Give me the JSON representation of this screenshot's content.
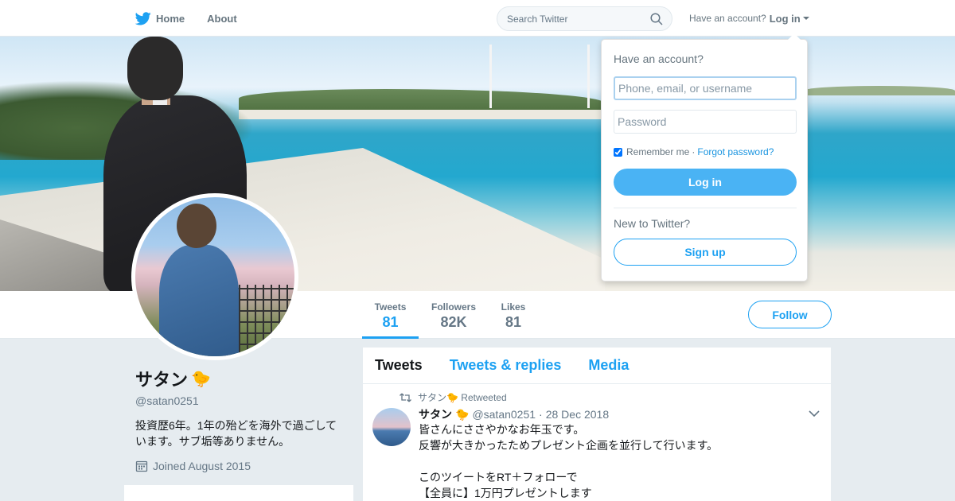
{
  "colors": {
    "brand": "#1da1f2",
    "button_blue": "#4ab3f4",
    "text_primary": "#14171a",
    "text_secondary": "#657786",
    "background": "#e6ecf0"
  },
  "nav": {
    "home_label": "Home",
    "home_icon": "twitter-bird-icon",
    "about_label": "About",
    "search_placeholder": "Search Twitter",
    "search_icon": "search-icon",
    "have_account_label": "Have an account?",
    "login_label": "Log in"
  },
  "login_dropdown": {
    "title": "Have an account?",
    "username_placeholder": "Phone, email, or username",
    "password_placeholder": "Password",
    "remember_label": "Remember me",
    "separator": "·",
    "forgot_label": "Forgot password?",
    "login_button": "Log in",
    "new_label": "New to Twitter?",
    "signup_button": "Sign up"
  },
  "stats": [
    {
      "label": "Tweets",
      "value": "81"
    },
    {
      "label": "Followers",
      "value": "82K"
    },
    {
      "label": "Likes",
      "value": "81"
    }
  ],
  "follow_button": "Follow",
  "profile": {
    "name": "サタン",
    "emoji": "🐤",
    "handle": "@satan0251",
    "bio": "投資歴6年。1年の殆どを海外で過ごしています。サブ垢等ありません。",
    "joined": "Joined August 2015",
    "calendar_icon": "calendar-icon"
  },
  "tabs": [
    {
      "label": "Tweets"
    },
    {
      "label": "Tweets & replies"
    },
    {
      "label": "Media"
    }
  ],
  "tweet": {
    "retweet_icon": "retweet-icon",
    "retweeted_by": "サタン🐤 Retweeted",
    "author_name": "サタン",
    "author_emoji": "🐤",
    "author_handle": "@satan0251",
    "separator": "·",
    "date": "28 Dec 2018",
    "menu_icon": "chevron-down-icon",
    "lines": [
      "皆さんにささやかなお年玉です。",
      "反響が大きかったためプレゼント企画を並行して行います。",
      "",
      "このツイートをRT＋フォローで",
      "【全員に】1万円プレゼントします"
    ]
  }
}
